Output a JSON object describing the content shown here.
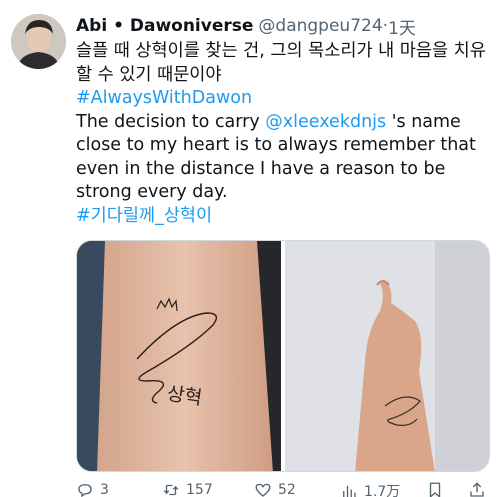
{
  "tweet": {
    "display_name": "Abi • Dawoniverse",
    "handle": "@dangpeu724",
    "separator": "·",
    "time": "1天",
    "line_korean": "슬플 때 상혁이를 찾는 건, 그의 목소리가 내 마음을 치유할 수 있기 때문이야",
    "hashtag1": "#AlwaysWithDawon",
    "text_before_mention": "The decision to carry ",
    "mention": "@xleexekdnjs",
    "text_after_mention": " 's name close to my heart is to always remember that even in the distance I have a reason to be strong every day.",
    "hashtag2": "#기다릴께_상혁이",
    "tattoo_text": "상혁"
  },
  "actions": {
    "replies": "3",
    "retweets": "157",
    "likes": "52",
    "views": "1.7万"
  },
  "colors": {
    "link": "#1d9bf0",
    "secondary_text": "#536471",
    "primary_text": "#0f1419"
  }
}
